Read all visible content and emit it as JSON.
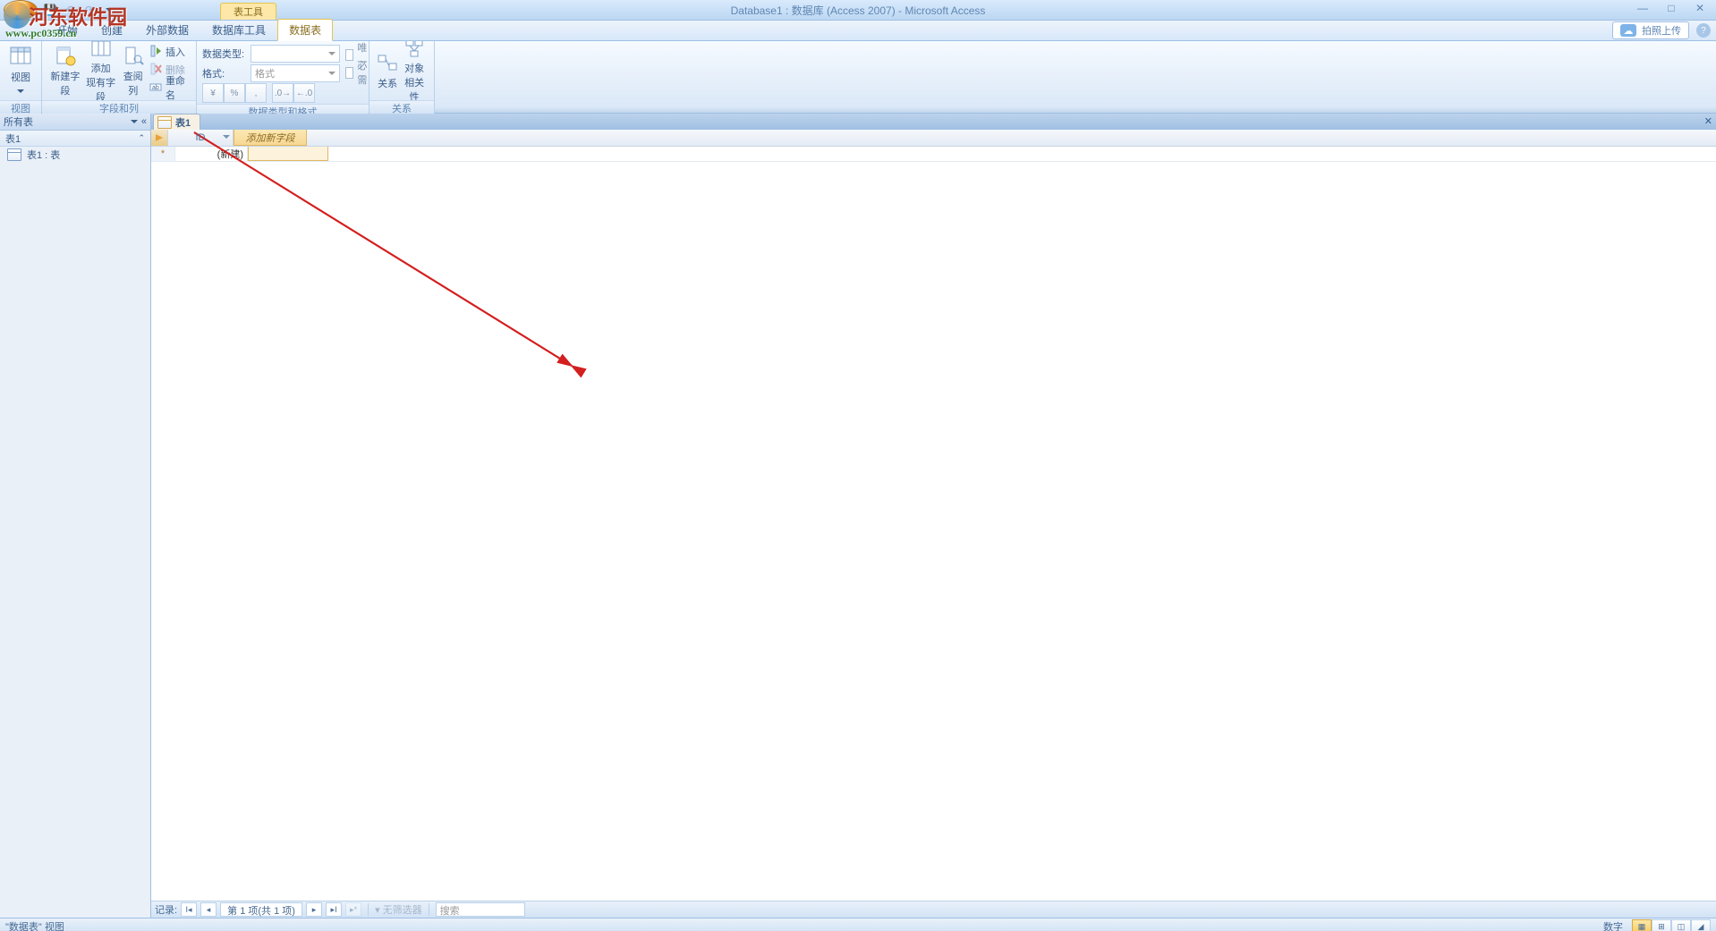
{
  "watermark": {
    "text": "河东软件园",
    "url": "www.pc0359.cn"
  },
  "window": {
    "title": "Database1 : 数据库 (Access 2007) - Microsoft Access",
    "context_tab_group": "表工具"
  },
  "tabs": {
    "t1": "开始",
    "t2": "创建",
    "t3": "外部数据",
    "t4": "数据库工具",
    "t5": "数据表"
  },
  "upload_label": "拍照上传",
  "ribbon": {
    "group_view": "视图",
    "view_btn": "视图",
    "group_fields": "字段和列",
    "new_field": "新建字段",
    "add_existing": "添加\n现有字段",
    "lookup": "查阅列",
    "insert": "插入",
    "delete": "删除",
    "rename": "重命名",
    "group_typefmt": "数据类型和格式",
    "data_type_label": "数据类型:",
    "format_label": "格式:",
    "format_value": "格式",
    "unique": "唯一",
    "required": "必需",
    "group_rel": "关系",
    "relations": "关系",
    "obj_dep": "对象\n相关性"
  },
  "navpane": {
    "header": "所有表",
    "group1": "表1",
    "item1": "表1 : 表"
  },
  "doc": {
    "tab_label": "表1",
    "col_id": "ID",
    "col_add": "添加新字段",
    "cell_new": "(新建)"
  },
  "recordnav": {
    "label": "记录:",
    "position": "第 1 项(共 1 项)",
    "no_filter": "无筛选器",
    "search": "搜索"
  },
  "status": {
    "left": "\"数据表\" 视图",
    "numlock": "数字"
  }
}
